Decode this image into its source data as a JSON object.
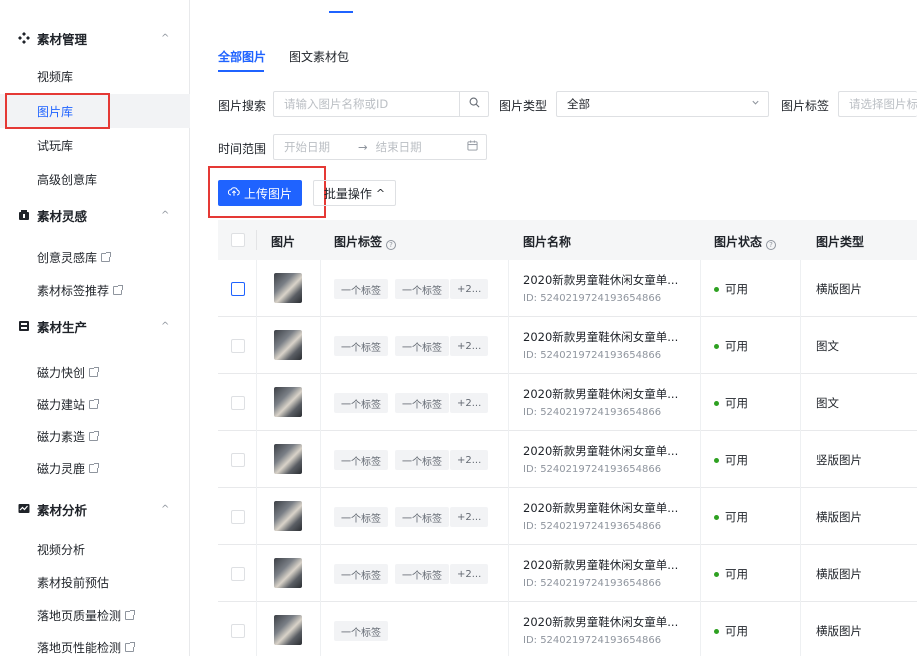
{
  "sidebar": {
    "groups": [
      {
        "title": "素材管理",
        "icon": "diamond-cluster-icon",
        "items": [
          {
            "label": "视频库",
            "external": false
          },
          {
            "label": "图片库",
            "external": false,
            "active": true
          },
          {
            "label": "试玩库",
            "external": false
          },
          {
            "label": "高级创意库",
            "external": false
          }
        ]
      },
      {
        "title": "素材灵感",
        "icon": "lightbulb-box-icon",
        "items": [
          {
            "label": "创意灵感库",
            "external": true
          },
          {
            "label": "素材标签推荐",
            "external": true
          }
        ]
      },
      {
        "title": "素材生产",
        "icon": "factory-box-icon",
        "items": [
          {
            "label": "磁力快创",
            "external": true
          },
          {
            "label": "磁力建站",
            "external": true
          },
          {
            "label": "磁力素造",
            "external": true
          },
          {
            "label": "磁力灵鹿",
            "external": true
          }
        ]
      },
      {
        "title": "素材分析",
        "icon": "chart-box-icon",
        "items": [
          {
            "label": "视频分析",
            "external": false
          },
          {
            "label": "素材投前预估",
            "external": false
          },
          {
            "label": "落地页质量检测",
            "external": true
          },
          {
            "label": "落地页性能检测",
            "external": true
          }
        ]
      }
    ]
  },
  "tabs": [
    {
      "label": "全部图片",
      "active": true
    },
    {
      "label": "图文素材包",
      "active": false
    }
  ],
  "filters": {
    "search_label": "图片搜索",
    "search_placeholder": "请输入图片名称或ID",
    "type_label": "图片类型",
    "type_value": "全部",
    "tag_label": "图片标签",
    "tag_placeholder": "请选择图片标",
    "time_label": "时间范围",
    "start_placeholder": "开始日期",
    "arrow": "→",
    "end_placeholder": "结束日期"
  },
  "actions": {
    "upload_label": "上传图片",
    "batch_label": "批量操作",
    "batch_caret": "^"
  },
  "table": {
    "headers": {
      "image": "图片",
      "tags": "图片标签",
      "name": "图片名称",
      "status": "图片状态",
      "type": "图片类型"
    },
    "rows": [
      {
        "tags": [
          "一个标签",
          "一个标签",
          "+2..."
        ],
        "name": "2020新款男童鞋休闲女童单...",
        "id": "ID: 5240219724193654866",
        "status": "可用",
        "type": "横版图片"
      },
      {
        "tags": [
          "一个标签",
          "一个标签",
          "+2..."
        ],
        "name": "2020新款男童鞋休闲女童单...",
        "id": "ID: 5240219724193654866",
        "status": "可用",
        "type": "图文"
      },
      {
        "tags": [
          "一个标签",
          "一个标签",
          "+2..."
        ],
        "name": "2020新款男童鞋休闲女童单...",
        "id": "ID: 5240219724193654866",
        "status": "可用",
        "type": "图文"
      },
      {
        "tags": [
          "一个标签",
          "一个标签",
          "+2..."
        ],
        "name": "2020新款男童鞋休闲女童单...",
        "id": "ID: 5240219724193654866",
        "status": "可用",
        "type": "竖版图片"
      },
      {
        "tags": [
          "一个标签",
          "一个标签",
          "+2..."
        ],
        "name": "2020新款男童鞋休闲女童单...",
        "id": "ID: 5240219724193654866",
        "status": "可用",
        "type": "横版图片"
      },
      {
        "tags": [
          "一个标签",
          "一个标签",
          "+2..."
        ],
        "name": "2020新款男童鞋休闲女童单...",
        "id": "ID: 5240219724193654866",
        "status": "可用",
        "type": "横版图片"
      },
      {
        "tags": [
          "一个标签"
        ],
        "name": "2020新款男童鞋休闲女童单...",
        "id": "ID: 5240219724193654866",
        "status": "可用",
        "type": "横版图片"
      }
    ]
  },
  "colors": {
    "accent": "#1f63ff",
    "highlight_box": "#e53935",
    "status_ok": "#2ea121"
  }
}
